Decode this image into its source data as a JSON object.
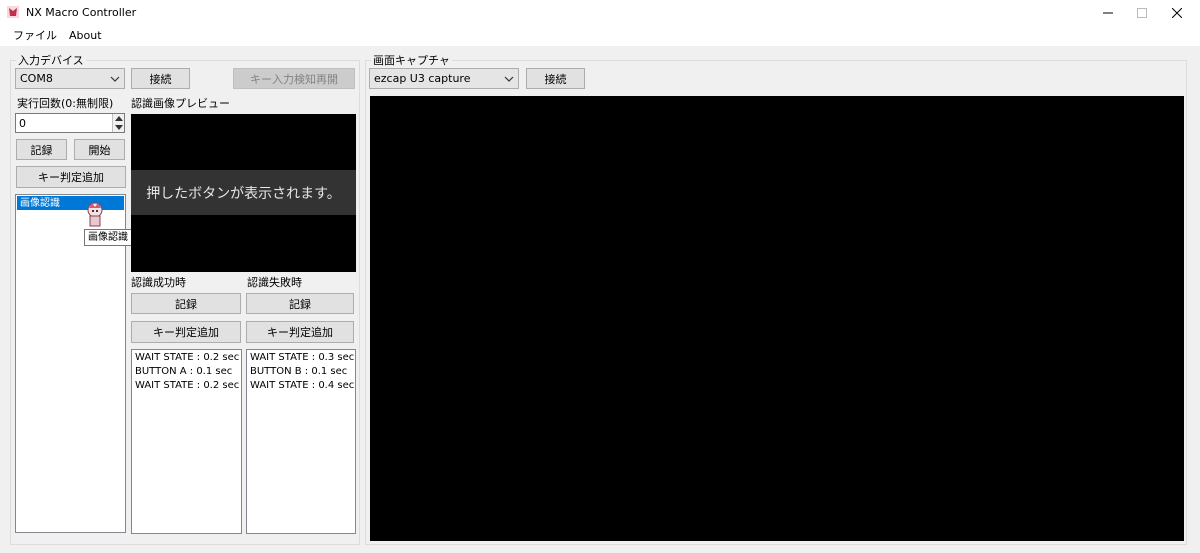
{
  "window": {
    "title": "NX Macro Controller",
    "minimize_icon": "minimize-icon",
    "maximize_icon": "maximize-icon",
    "close_icon": "close-icon"
  },
  "menu": {
    "file": "ファイル",
    "about": "About"
  },
  "input_device": {
    "group_label": "入力デバイス",
    "port_selected": "COM8",
    "connect_label": "接続",
    "resume_label": "キー入力検知再開"
  },
  "run_count": {
    "label": "実行回数(0:無制限)",
    "value": "0"
  },
  "buttons": {
    "record": "記録",
    "start": "開始",
    "add_key_check": "キー判定追加"
  },
  "macro_list": {
    "items": [
      "画像認識"
    ],
    "tooltip": "画像認識"
  },
  "preview": {
    "label": "認識画像プレビュー",
    "overlay_text": "押したボタンが表示されます。"
  },
  "on_success": {
    "label": "認識成功時",
    "record_label": "記録",
    "add_key_label": "キー判定追加",
    "steps": [
      "WAIT STATE : 0.2 sec",
      "BUTTON A : 0.1 sec",
      "WAIT STATE : 0.2 sec"
    ]
  },
  "on_failure": {
    "label": "認識失敗時",
    "record_label": "記録",
    "add_key_label": "キー判定追加",
    "steps": [
      "WAIT STATE : 0.3 sec",
      "BUTTON B : 0.1 sec",
      "WAIT STATE : 0.4 sec"
    ]
  },
  "capture": {
    "group_label": "画面キャプチャ",
    "device_selected": "ezcap U3 capture",
    "connect_label": "接続"
  },
  "colors": {
    "selection": "#0078d7",
    "preview_bg": "#000000",
    "overlay_bg": "#333333"
  }
}
